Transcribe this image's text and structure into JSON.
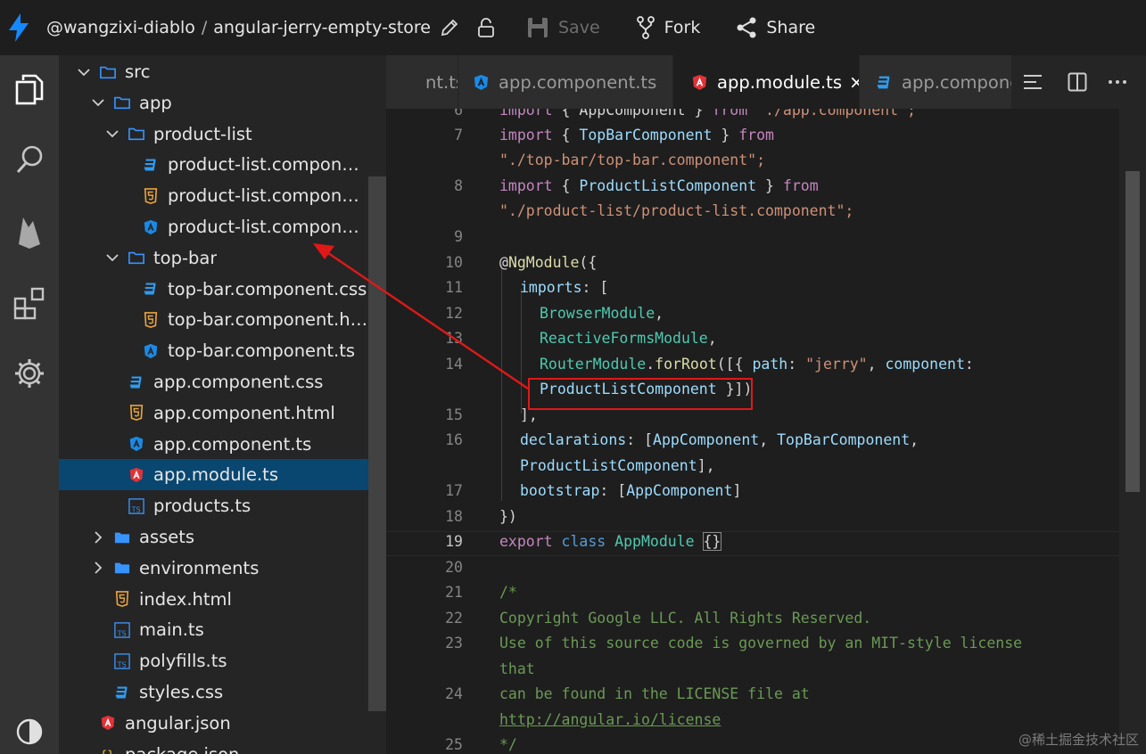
{
  "header": {
    "owner": "@wangzixi-diablo",
    "separator": "/",
    "project": "angular-jerry-empty-store",
    "save_label": "Save",
    "fork_label": "Fork",
    "share_label": "Share"
  },
  "explorer": {
    "items": [
      {
        "label": "src",
        "type": "folder-open"
      },
      {
        "label": "app",
        "type": "folder-open"
      },
      {
        "label": "product-list",
        "type": "folder-open"
      },
      {
        "label": "product-list.component.css",
        "type": "css"
      },
      {
        "label": "product-list.component.html",
        "type": "html"
      },
      {
        "label": "product-list.component.ts",
        "type": "angular"
      },
      {
        "label": "top-bar",
        "type": "folder-open"
      },
      {
        "label": "top-bar.component.css",
        "type": "css"
      },
      {
        "label": "top-bar.component.html",
        "type": "html"
      },
      {
        "label": "top-bar.component.ts",
        "type": "angular"
      },
      {
        "label": "app.component.css",
        "type": "css"
      },
      {
        "label": "app.component.html",
        "type": "html"
      },
      {
        "label": "app.component.ts",
        "type": "angular"
      },
      {
        "label": "app.module.ts",
        "type": "angular-red"
      },
      {
        "label": "products.ts",
        "type": "ts"
      },
      {
        "label": "assets",
        "type": "folder-closed"
      },
      {
        "label": "environments",
        "type": "folder-closed"
      },
      {
        "label": "index.html",
        "type": "html"
      },
      {
        "label": "main.ts",
        "type": "ts"
      },
      {
        "label": "polyfills.ts",
        "type": "ts"
      },
      {
        "label": "styles.css",
        "type": "css"
      },
      {
        "label": "angular.json",
        "type": "angular-red"
      },
      {
        "label": "package.json",
        "type": "json"
      }
    ]
  },
  "tabs": [
    {
      "label": "app.component.ts",
      "type": "ts-partial"
    },
    {
      "label": "app.component.ts",
      "type": "angular"
    },
    {
      "label": "app.module.ts",
      "type": "angular-red",
      "active": true,
      "close": "×"
    },
    {
      "label": "app.component.css",
      "type": "css"
    }
  ],
  "editor": {
    "current_line": "19",
    "line_numbers": [
      "6",
      "7",
      "8",
      "9",
      "10",
      "11",
      "12",
      "13",
      "14",
      "15",
      "16",
      "17",
      "18",
      "19",
      "20",
      "21",
      "22",
      "23",
      "24",
      "25"
    ],
    "lines": {
      "l6": {
        "a": "import",
        "b": " { AppComponent } ",
        "c": "from",
        "d": " \"./app.component\";"
      },
      "l7a": {
        "a": "import",
        "b": " { ",
        "c": "TopBarComponent",
        "d": " } ",
        "e": "from"
      },
      "l7b": "\"./top-bar/top-bar.component\";",
      "l8a": {
        "a": "import",
        "b": " { ",
        "c": "ProductListComponent",
        "d": " } ",
        "e": "from"
      },
      "l8b": "\"./product-list/product-list.component\";",
      "l10": {
        "a": "@",
        "b": "NgModule",
        "c": "({"
      },
      "l11": {
        "a": "imports",
        "b": ": ["
      },
      "l12": {
        "a": "BrowserModule",
        "b": ","
      },
      "l13": {
        "a": "ReactiveFormsModule",
        "b": ","
      },
      "l14a": {
        "a": "RouterModule",
        "b": ".",
        "c": "forRoot",
        "d": "([{ ",
        "e": "path",
        "f": ": ",
        "g": "\"jerry\"",
        "h": ", ",
        "i": "component",
        "j": ":"
      },
      "l14b": {
        "a": "ProductListComponent",
        "b": " }])"
      },
      "l15": "],",
      "l16a": {
        "a": "declarations",
        "b": ": [",
        "c": "AppComponent",
        "d": ", ",
        "e": "TopBarComponent",
        "f": ","
      },
      "l16b": {
        "a": "ProductListComponent",
        "b": "],"
      },
      "l17": {
        "a": "bootstrap",
        "b": ": [",
        "c": "AppComponent",
        "d": "]"
      },
      "l18": "})",
      "l19": {
        "a": "export",
        "b": " ",
        "c": "class",
        "d": " ",
        "e": "AppModule",
        "f": " ",
        "g": "{}"
      },
      "l21": "/*",
      "l22": "Copyright Google LLC. All Rights Reserved.",
      "l23a": "Use of this source code is governed by an MIT-style license",
      "l23b": "that",
      "l24a": "can be found in the LICENSE file at",
      "l24b": "http://angular.io/license",
      "l25": "*/"
    }
  },
  "watermark": "@稀土掘金技术社区",
  "colors": {
    "accent": "#0098ff",
    "selection": "#094771",
    "annotation": "#e01818"
  }
}
